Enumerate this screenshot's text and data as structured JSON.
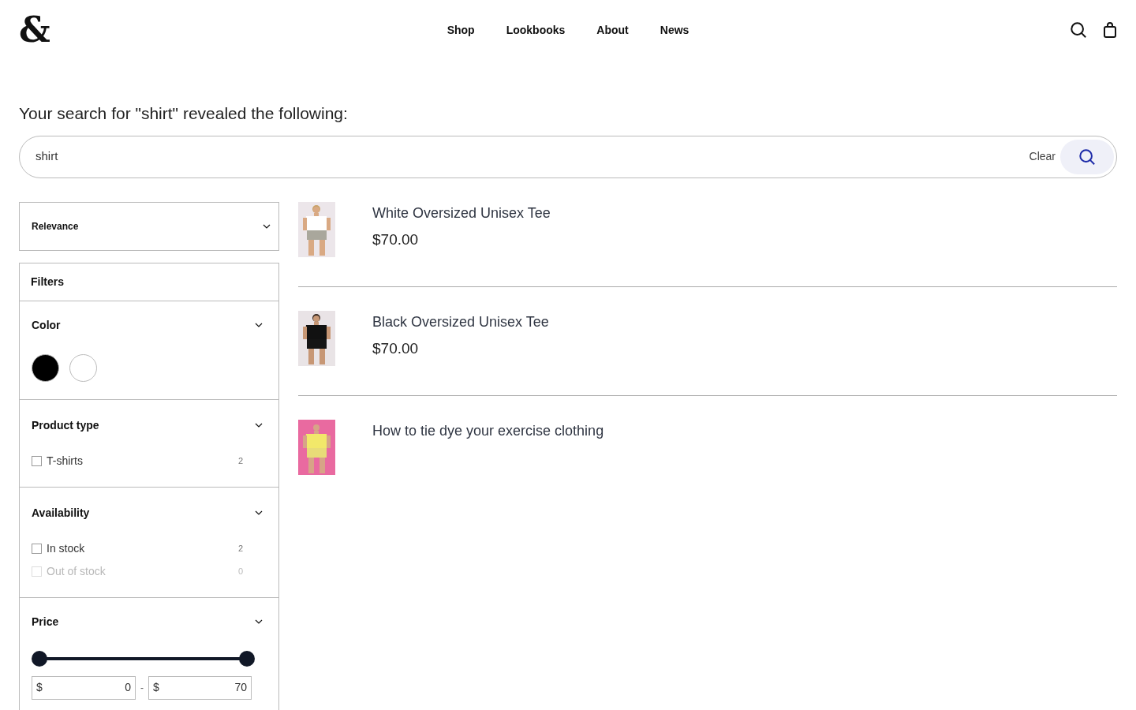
{
  "header": {
    "logo": "&",
    "nav": [
      "Shop",
      "Lookbooks",
      "About",
      "News"
    ]
  },
  "search": {
    "heading": "Your search for \"shirt\" revealed the following:",
    "value": "shirt",
    "clear": "Clear"
  },
  "sort": {
    "value": "Relevance"
  },
  "filters": {
    "title": "Filters",
    "color": {
      "title": "Color",
      "swatches": [
        {
          "color": "#000000",
          "selected": false
        },
        {
          "color": "#ffffff",
          "selected": false
        }
      ]
    },
    "product_type": {
      "title": "Product type",
      "options": [
        {
          "label": "T-shirts",
          "count": "2",
          "checked": false,
          "disabled": false
        }
      ]
    },
    "availability": {
      "title": "Availability",
      "options": [
        {
          "label": "In stock",
          "count": "2",
          "checked": false,
          "disabled": false
        },
        {
          "label": "Out of stock",
          "count": "0",
          "checked": false,
          "disabled": true
        }
      ]
    },
    "price": {
      "title": "Price",
      "handles": [
        {
          "level": 0
        },
        {
          "level": 1
        }
      ],
      "min": {
        "currency": "$",
        "value": "0"
      },
      "separator": "-",
      "max": {
        "currency": "$",
        "value": "70"
      }
    }
  },
  "results": [
    {
      "title": "White Oversized Unisex Tee",
      "price": "$70.00",
      "kind": "picture"
    },
    {
      "title": "Black Oversized Unisex Tee",
      "price": "$70.00",
      "kind": "picture"
    },
    {
      "title": "How to tie dye your exercise clothing",
      "kind": "picture"
    }
  ]
}
